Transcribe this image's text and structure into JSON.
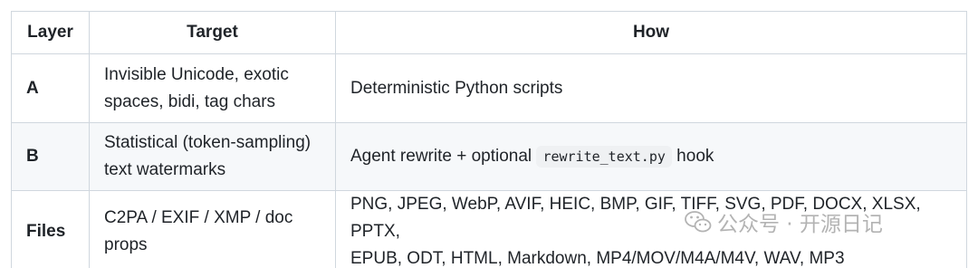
{
  "table": {
    "headers": {
      "layer": "Layer",
      "target": "Target",
      "how": "How"
    },
    "rows": [
      {
        "layer": "A",
        "target_line1": "Invisible Unicode, exotic",
        "target_line2": "spaces, bidi, tag chars",
        "how": "Deterministic Python scripts"
      },
      {
        "layer": "B",
        "target_line1": "Statistical (token-sampling)",
        "target_line2": "text watermarks",
        "how_prefix": "Agent rewrite + optional ",
        "how_code": "rewrite_text.py",
        "how_suffix": " hook"
      },
      {
        "layer": "Files",
        "target_line1": "C2PA / EXIF / XMP / doc",
        "target_line2": "props",
        "how_line1": "PNG, JPEG, WebP, AVIF, HEIC, BMP, GIF, TIFF, SVG, PDF, DOCX, XLSX, PPTX,",
        "how_line2": "EPUB, ODT, HTML, Markdown, MP4/MOV/M4A/M4V, WAV, MP3"
      }
    ]
  },
  "watermark": {
    "text": "公众号 · 开源日记",
    "icon": "wechat-icon"
  }
}
